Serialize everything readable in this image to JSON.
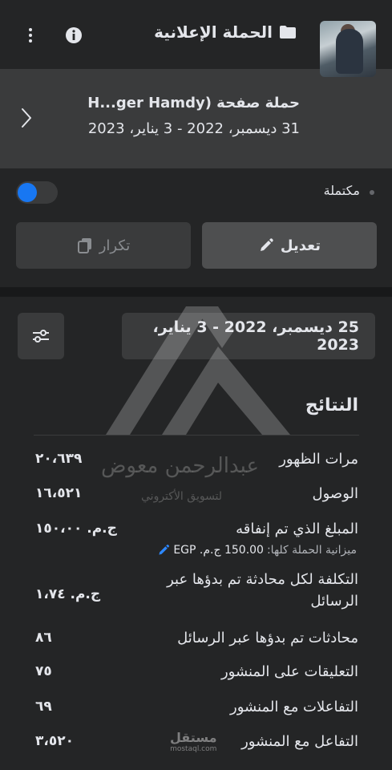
{
  "header": {
    "title": "الحملة الإعلانية",
    "icons": [
      "close-icon",
      "folder-icon",
      "info-icon",
      "more-vertical-icon"
    ]
  },
  "campaign": {
    "name": "حملة صفحة (H...ger Hamdy",
    "dates": "31 ديسمبر، 2022 - 3 يناير، 2023"
  },
  "status": {
    "label": "مكتملة",
    "toggle_on": true
  },
  "actions": {
    "edit_label": "تعديل",
    "duplicate_label": "تكرار"
  },
  "filters": {
    "date_range": "25 ديسمبر، 2022 - 3 يناير، 2023"
  },
  "results": {
    "title": "النتائج",
    "metrics": [
      {
        "label": "مرات الظهور",
        "value": "٢٠،٦٣٩"
      },
      {
        "label": "الوصول",
        "value": "١٦،٥٢١"
      },
      {
        "label": "المبلغ الذي تم إنفاقه",
        "value": "ج.م. ١٥٠،٠٠"
      },
      {
        "label_line1": "التكلفة لكل محادثة تم بدؤها عبر",
        "label_line2": "الرسائل",
        "value": "ج.م. ١،٧٤"
      },
      {
        "label": "محادثات تم بدؤها عبر الرسائل",
        "value": "٨٦"
      },
      {
        "label": "التعليقات على المنشور",
        "value": "٧٥"
      },
      {
        "label": "التفاعلات مع المنشور",
        "value": "٦٩"
      },
      {
        "label": "التفاعل مع المنشور",
        "value": "٣،٥٢٠"
      }
    ],
    "budget_label": "ميزانية الحملة كلها:",
    "budget_value": "150.00 ج.م. EGP"
  },
  "watermark": {
    "name": "عبدالرحمن معوض",
    "subtitle": "لتسويق الأكتروني",
    "site_ar": "مستقل",
    "site_en": "mostaql.com"
  },
  "colors": {
    "background": "#242526",
    "card": "#3a3b3c",
    "accent": "#1877f2",
    "separator": "#18191a"
  }
}
